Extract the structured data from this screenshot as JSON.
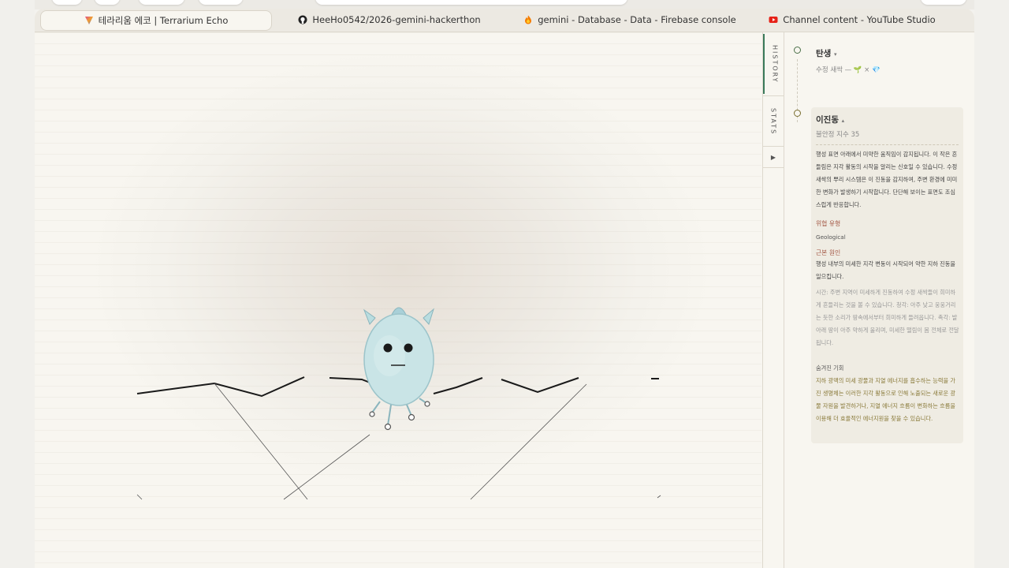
{
  "tabs": [
    {
      "label": "테라리움 에코 | Terrarium Echo",
      "icon": "triangle-app-icon",
      "active": true
    },
    {
      "label": "HeeHo0542/2026-gemini-hackerthon",
      "icon": "github-icon",
      "active": false
    },
    {
      "label": "gemini - Database - Data - Firebase console",
      "icon": "firebase-icon",
      "active": false
    },
    {
      "label": "Channel content - YouTube Studio",
      "icon": "youtube-icon",
      "active": false
    }
  ],
  "side_tabs": {
    "history": "HISTORY",
    "stats": "STATS",
    "play": "▶"
  },
  "timeline": {
    "birth": {
      "title": "탄생",
      "caret": "▾",
      "detail": "수정 새싹 — 🌱 × 💎"
    },
    "event": {
      "title": "이진동",
      "caret": "▴",
      "sub": "불안정 지수 35",
      "description": "행성 표면 아래에서 미약한 움직임이 감지됩니다. 이 작은 흔들림은 지각 활동의 시작을 알리는 신호일 수 있습니다. 수정 새싹의 뿌리 시스템은 이 진동을 감지하여, 주변 환경에 미미한 변화가 발생하기 시작합니다. 단단해 보이는 표면도 조심스럽게 반응합니다.",
      "threat_label": "위협 유형",
      "threat_value": "Geological",
      "cause_label": "근본 원인",
      "cause_value": "행성 내부의 미세한 지각 변동이 시작되어 약한 지하 진동을 일으킵니다.",
      "notes": "시간: 주변 지역이 미세하게 진동하여 수정 새싹들이 희미하게 흔들리는 것을 볼 수 있습니다. 청각: 아주 낮고 웅웅거리는 듯한 소리가 땅속에서부터 희미하게 들려옵니다. 촉각: 발아래 땅이 아주 약하게 울리며, 미세한 떨림이 몸 전체로 전달됩니다.",
      "opportunity_label": "숨겨진 기회",
      "opportunity_value": "지하 광맥의 미세 광물과 지열 에너지를 흡수하는 능력을 가진 생명체는 이러한 지각 활동으로 인해 노출되는 새로운 광물 자원을 발견하거나, 지열 에너지 흐름이 변화하는 흐름을 이용해 더 효율적인 에너지원을 찾을 수 있습니다."
    }
  }
}
